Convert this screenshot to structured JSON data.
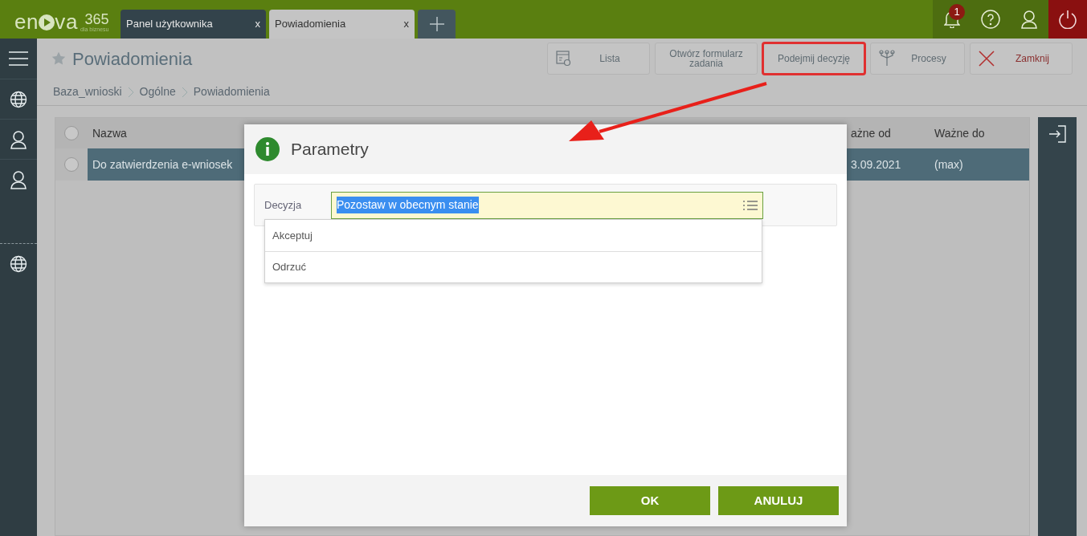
{
  "logo": {
    "left": "en",
    "right": "va",
    "number": "365",
    "tagline": "dla biznesu"
  },
  "tabs": [
    {
      "label": "Panel użytkownika",
      "close": "x",
      "selected": false
    },
    {
      "label": "Powiadomienia",
      "close": "x",
      "selected": true
    }
  ],
  "notifications": {
    "count": "1"
  },
  "page": {
    "title": "Powiadomienia",
    "favorite": false
  },
  "toolbar": [
    {
      "label": "Lista",
      "kind": "list",
      "highlighted": false
    },
    {
      "label": "Otwórz formularz zadania",
      "kind": "plain",
      "highlighted": false
    },
    {
      "label": "Podejmij decyzję",
      "kind": "plain",
      "highlighted": true
    },
    {
      "label": "Procesy",
      "kind": "fork",
      "highlighted": false
    },
    {
      "label": "Zamknij",
      "kind": "close",
      "highlighted": false
    }
  ],
  "breadcrumb": [
    "Baza_wnioski",
    "Ogólne",
    "Powiadomienia"
  ],
  "table": {
    "all_selected": false,
    "columns": [
      "Nazwa",
      "ażne od",
      "Ważne do"
    ],
    "rows": [
      {
        "selected": true,
        "cells": [
          "Do zatwierdzenia e-wniosek",
          "3.09.2021",
          "(max)"
        ]
      }
    ]
  },
  "dialog": {
    "title": "Parametry",
    "field": {
      "label": "Decyzja",
      "value": "Pozostaw w obecnym stanie"
    },
    "options": [
      {
        "label": "Akceptuj"
      },
      {
        "label": "Odrzuć"
      }
    ],
    "buttons": [
      "OK",
      "ANULUJ"
    ]
  }
}
